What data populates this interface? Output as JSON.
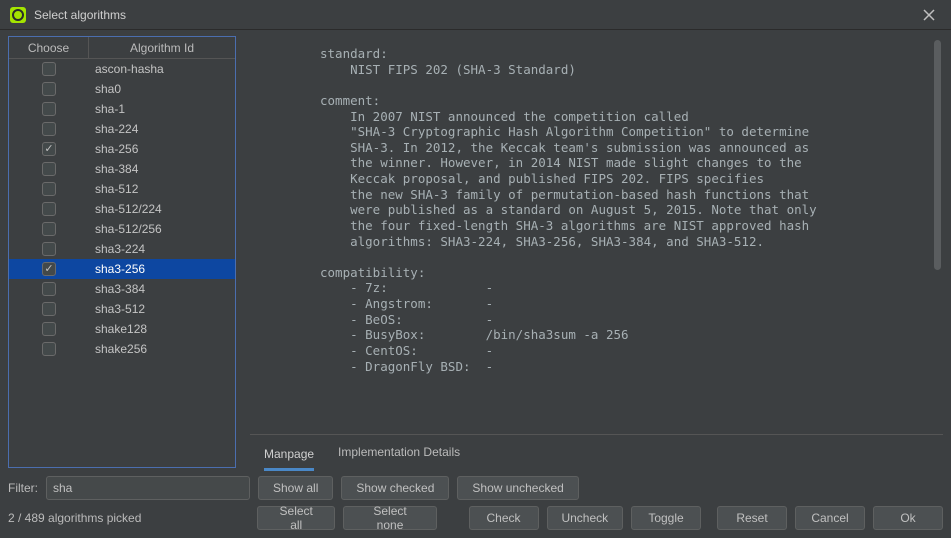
{
  "window": {
    "title": "Select algorithms"
  },
  "table": {
    "headers": {
      "choose": "Choose",
      "id": "Algorithm Id"
    },
    "rows": [
      {
        "id": "ascon-hasha",
        "checked": false,
        "selected": false
      },
      {
        "id": "sha0",
        "checked": false,
        "selected": false
      },
      {
        "id": "sha-1",
        "checked": false,
        "selected": false
      },
      {
        "id": "sha-224",
        "checked": false,
        "selected": false
      },
      {
        "id": "sha-256",
        "checked": true,
        "selected": false
      },
      {
        "id": "sha-384",
        "checked": false,
        "selected": false
      },
      {
        "id": "sha-512",
        "checked": false,
        "selected": false
      },
      {
        "id": "sha-512/224",
        "checked": false,
        "selected": false
      },
      {
        "id": "sha-512/256",
        "checked": false,
        "selected": false
      },
      {
        "id": "sha3-224",
        "checked": false,
        "selected": false
      },
      {
        "id": "sha3-256",
        "checked": true,
        "selected": true
      },
      {
        "id": "sha3-384",
        "checked": false,
        "selected": false
      },
      {
        "id": "sha3-512",
        "checked": false,
        "selected": false
      },
      {
        "id": "shake128",
        "checked": false,
        "selected": false
      },
      {
        "id": "shake256",
        "checked": false,
        "selected": false
      }
    ]
  },
  "detail_text": "standard:\n    NIST FIPS 202 (SHA-3 Standard)\n\ncomment:\n    In 2007 NIST announced the competition called\n    \"SHA-3 Cryptographic Hash Algorithm Competition\" to determine\n    SHA-3. In 2012, the Keccak team's submission was announced as\n    the winner. However, in 2014 NIST made slight changes to the\n    Keccak proposal, and published FIPS 202. FIPS specifies\n    the new SHA-3 family of permutation-based hash functions that\n    were published as a standard on August 5, 2015. Note that only\n    the four fixed-length SHA-3 algorithms are NIST approved hash\n    algorithms: SHA3-224, SHA3-256, SHA3-384, and SHA3-512.\n\ncompatibility:\n    - 7z:             -\n    - Angstrom:       -\n    - BeOS:           -\n    - BusyBox:        /bin/sha3sum -a 256\n    - CentOS:         -\n    - DragonFly BSD:  -",
  "tabs": {
    "manpage": "Manpage",
    "impl": "Implementation Details",
    "active": "manpage"
  },
  "filter": {
    "label": "Filter:",
    "value": "sha"
  },
  "buttons": {
    "show_all": "Show all",
    "show_checked": "Show checked",
    "show_unchecked": "Show unchecked",
    "select_all": "Select all",
    "select_none": "Select none",
    "check": "Check",
    "uncheck": "Uncheck",
    "toggle": "Toggle",
    "reset": "Reset",
    "cancel": "Cancel",
    "ok": "Ok"
  },
  "status": {
    "picked": "2 / 489 algorithms picked"
  }
}
